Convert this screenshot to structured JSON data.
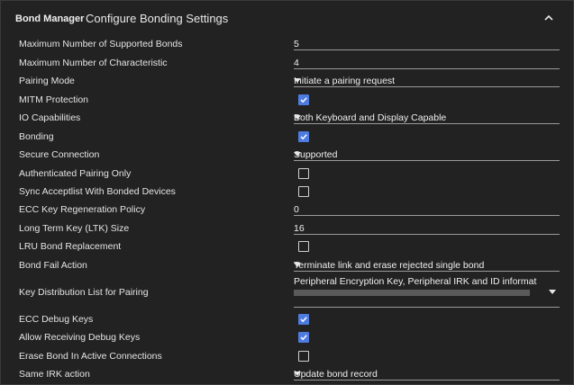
{
  "header": {
    "app_name": "Bond Manager",
    "section_title": "Configure Bonding Settings",
    "collapse_icon": "chevron-up-icon"
  },
  "settings": {
    "max_bonds": {
      "label": "Maximum Number of Supported Bonds",
      "value": "5"
    },
    "max_characteristic": {
      "label": "Maximum Number of Characteristic",
      "value": "4"
    },
    "pairing_mode": {
      "label": "Pairing Mode",
      "value": "Initiate a pairing request"
    },
    "mitm_protection": {
      "label": "MITM Protection",
      "checked": true
    },
    "io_capabilities": {
      "label": "IO Capabilities",
      "value": "Both Keyboard and Display Capable"
    },
    "bonding": {
      "label": "Bonding",
      "checked": true
    },
    "secure_connection": {
      "label": "Secure Connection",
      "value": "Supported"
    },
    "authenticated_pairing_only": {
      "label": "Authenticated Pairing Only",
      "checked": false
    },
    "sync_acceptlist": {
      "label": "Sync Acceptlist With Bonded Devices",
      "checked": false
    },
    "ecc_key_regen": {
      "label": "ECC Key Regeneration Policy",
      "value": "0"
    },
    "ltk_size": {
      "label": "Long Term Key (LTK) Size",
      "value": "16"
    },
    "lru_bond_replacement": {
      "label": "LRU Bond Replacement",
      "checked": false
    },
    "bond_fail_action": {
      "label": "Bond Fail Action",
      "value": "Terminate link and erase rejected single bond"
    },
    "key_distribution": {
      "label": "Key Distribution List for Pairing",
      "value": "Peripheral Encryption Key, Peripheral IRK and ID informatio"
    },
    "ecc_debug_keys": {
      "label": "ECC Debug Keys",
      "checked": true
    },
    "allow_debug_keys": {
      "label": "Allow Receiving Debug Keys",
      "checked": true
    },
    "erase_bond_active": {
      "label": "Erase Bond In Active Connections",
      "checked": false
    },
    "same_irk_action": {
      "label": "Same IRK action",
      "value": "Update bond record"
    }
  },
  "colors": {
    "checkbox_checked": "#4d7be0",
    "panel_bg": "#222222",
    "text": "#e4e4e4"
  }
}
